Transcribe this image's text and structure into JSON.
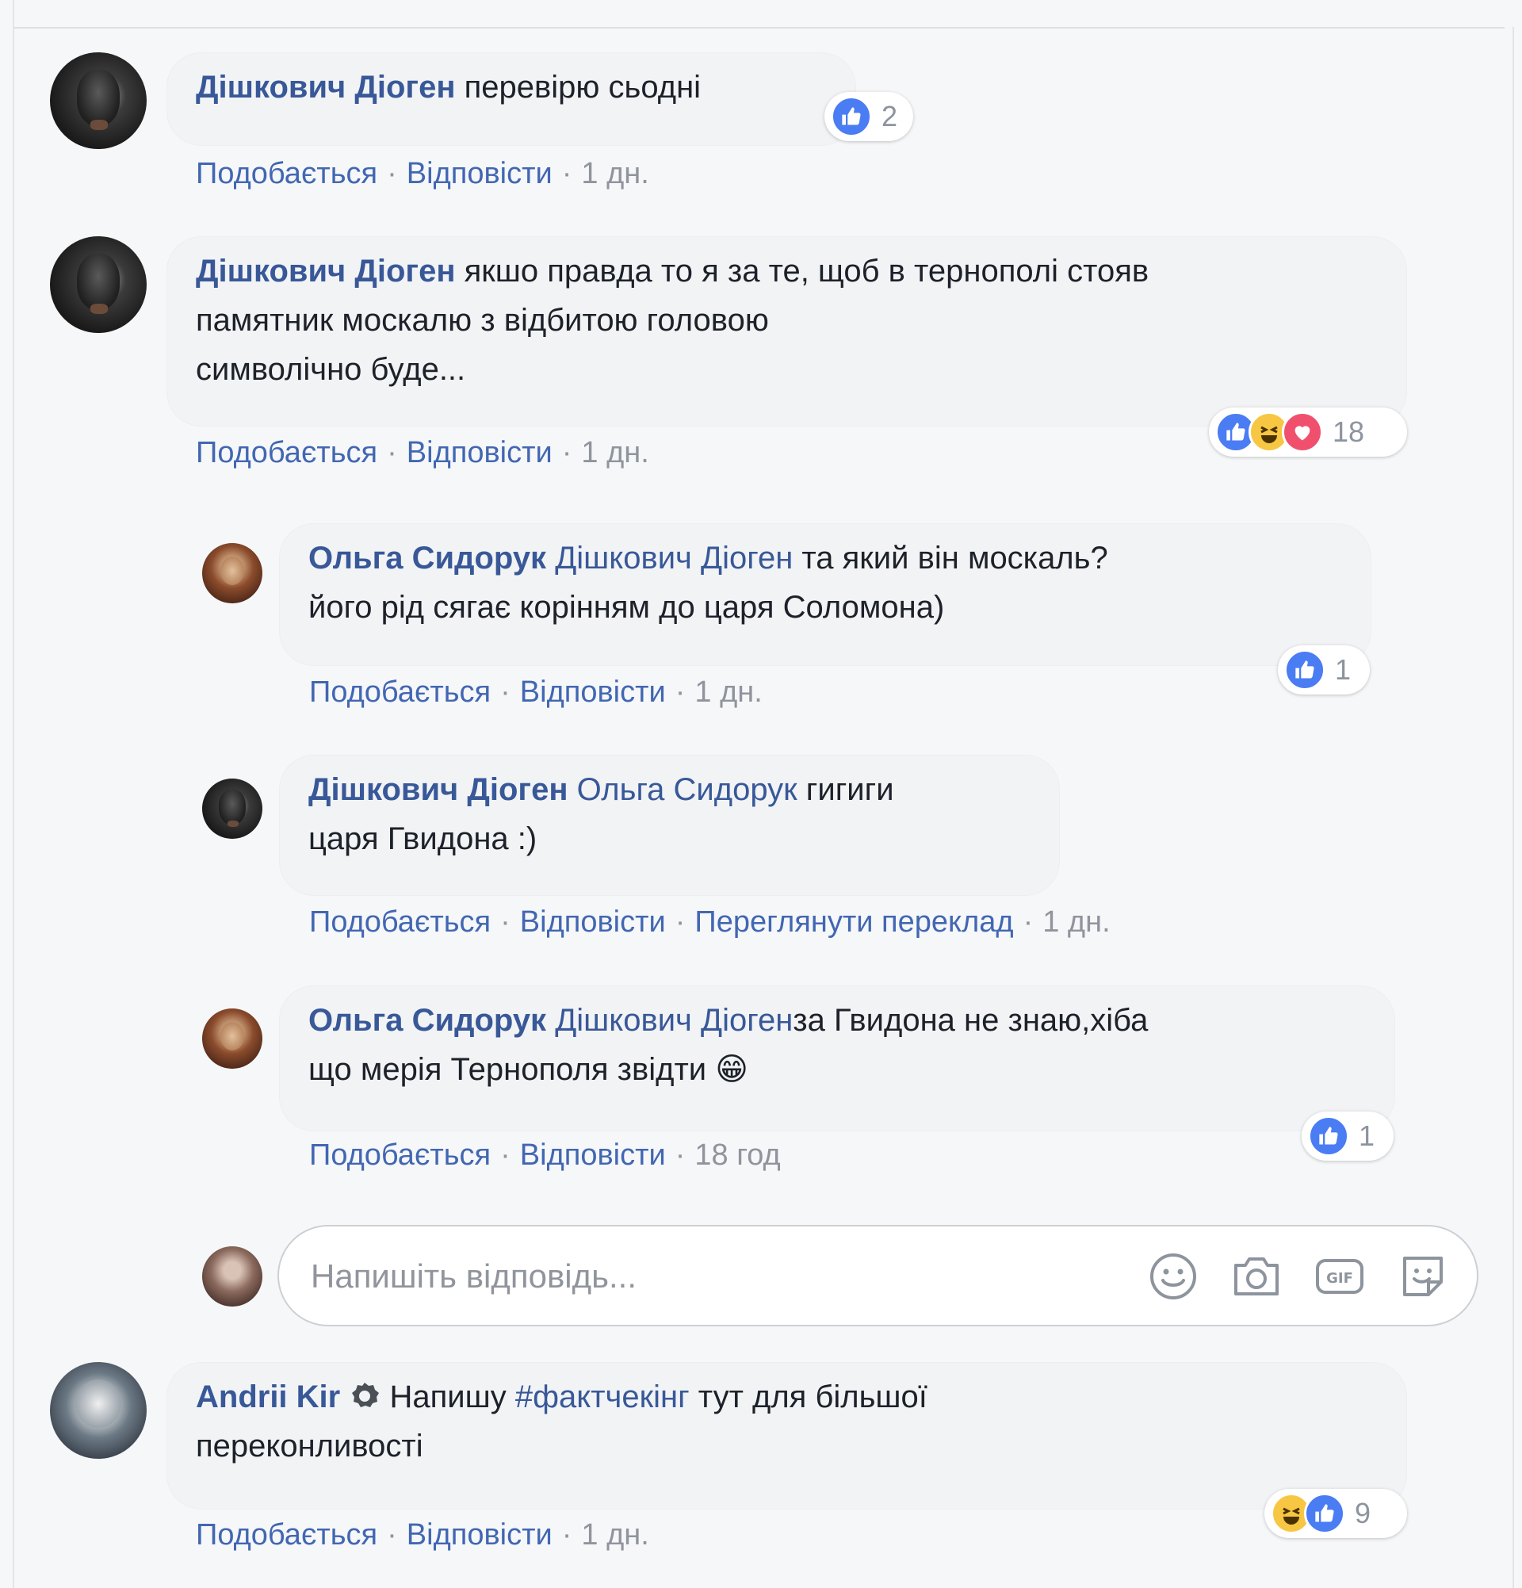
{
  "comments": [
    {
      "author": "Дішкович Діоген",
      "text": "перевірю сьодні",
      "actions": {
        "like": "Подобається",
        "reply": "Відповісти",
        "time": "1 дн."
      },
      "reactions": {
        "count": "2"
      }
    },
    {
      "author": "Дішкович Діоген",
      "lines": [
        "якшо правда то я за те, щоб в тернополі стояв",
        "памятник москалю з відбитою головою",
        "символічно буде..."
      ],
      "actions": {
        "like": "Подобається",
        "reply": "Відповісти",
        "time": "1 дн."
      },
      "reactions": {
        "count": "18"
      }
    },
    {
      "author": "Ольга Сидорук",
      "mention": "Дішкович Діоген",
      "line1": "та який він москаль?",
      "line2": "його рід сягає корінням до царя Соломона)",
      "actions": {
        "like": "Подобається",
        "reply": "Відповісти",
        "time": "1 дн."
      },
      "reactions": {
        "count": "1"
      }
    },
    {
      "author": "Дішкович Діоген",
      "mention": "Ольга Сидорук",
      "line1": "гигиги",
      "line2": "царя Гвидона :)",
      "actions": {
        "like": "Подобається",
        "reply": "Відповісти",
        "translate": "Переглянути переклад",
        "time": "1 дн."
      }
    },
    {
      "author": "Ольга Сидорук",
      "mention": "Дішкович Діоген",
      "line1": "за Гвидона не знаю,хіба",
      "line2": "що мерія Тернополя звідти",
      "emoji": "😁",
      "actions": {
        "like": "Подобається",
        "reply": "Відповісти",
        "time": "18 год"
      },
      "reactions": {
        "count": "1"
      }
    },
    {
      "author": "Andrii Kir",
      "pre": "Напишу",
      "hashtag": "#фактчекінг",
      "post": "тут для більшої",
      "line2": "переконливості",
      "actions": {
        "like": "Подобається",
        "reply": "Відповісти",
        "time": "1 дн."
      },
      "reactions": {
        "count": "9"
      }
    }
  ],
  "reply_box": {
    "placeholder": "Напишіть відповідь..."
  },
  "icons": [
    "emoji-icon",
    "camera-icon",
    "gif-icon",
    "sticker-icon",
    "badge-icon",
    "like-reaction-icon",
    "haha-reaction-icon",
    "love-reaction-icon"
  ],
  "colors": {
    "name": "#385898",
    "action": "#4267b2",
    "muted": "#90949c",
    "bubble": "#f2f3f5",
    "like": "#4a7cf3"
  }
}
